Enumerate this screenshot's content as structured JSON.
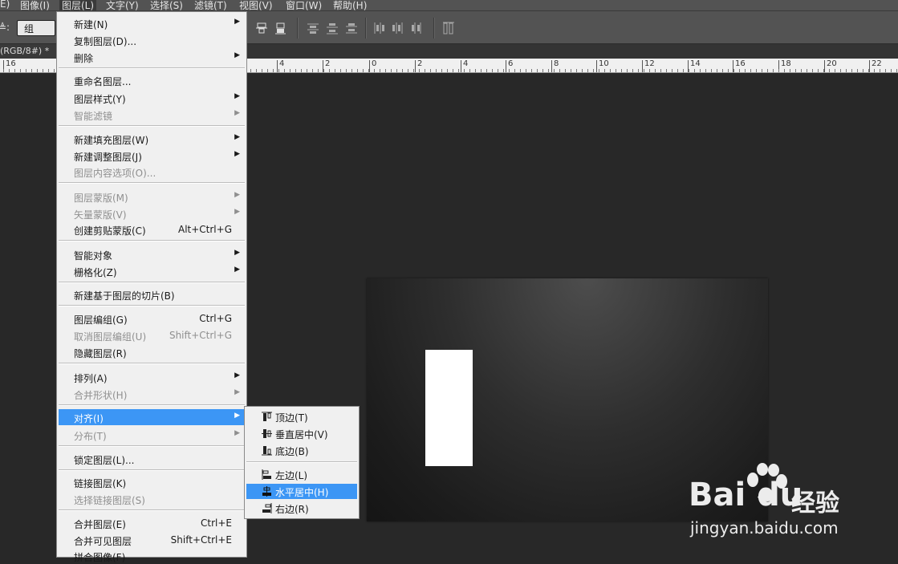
{
  "menubar": {
    "items": [
      {
        "label": "E)"
      },
      {
        "label": "图像(I)"
      },
      {
        "label": "图层(L)"
      },
      {
        "label": "文字(Y)"
      },
      {
        "label": "选择(S)"
      },
      {
        "label": "滤镜(T)"
      },
      {
        "label": "视图(V)"
      },
      {
        "label": "窗口(W)"
      },
      {
        "label": "帮助(H)"
      }
    ]
  },
  "options_bar": {
    "label": "≜:",
    "auto_select_value": "组"
  },
  "document": {
    "tab_title": "(RGB/8#) *",
    "ruler_labels": [
      "16",
      "4",
      "2",
      "0",
      "2",
      "4",
      "6",
      "8",
      "10",
      "12",
      "14",
      "16",
      "18",
      "20",
      "22"
    ]
  },
  "layer_menu": {
    "items": [
      {
        "label": "新建(N)",
        "submenu": true
      },
      {
        "label": "复制图层(D)..."
      },
      {
        "label": "删除",
        "submenu": true
      },
      {
        "label": "重命名图层..."
      },
      {
        "label": "图层样式(Y)",
        "submenu": true
      },
      {
        "label": "智能滤镜",
        "submenu": true,
        "disabled": true
      },
      {
        "label": "新建填充图层(W)",
        "submenu": true
      },
      {
        "label": "新建调整图层(J)",
        "submenu": true
      },
      {
        "label": "图层内容选项(O)...",
        "disabled": true
      },
      {
        "label": "图层蒙版(M)",
        "submenu": true,
        "disabled": true
      },
      {
        "label": "矢量蒙版(V)",
        "submenu": true,
        "disabled": true
      },
      {
        "label": "创建剪贴蒙版(C)",
        "shortcut": "Alt+Ctrl+G"
      },
      {
        "label": "智能对象",
        "submenu": true
      },
      {
        "label": "栅格化(Z)",
        "submenu": true
      },
      {
        "label": "新建基于图层的切片(B)"
      },
      {
        "label": "图层编组(G)",
        "shortcut": "Ctrl+G"
      },
      {
        "label": "取消图层编组(U)",
        "shortcut": "Shift+Ctrl+G",
        "disabled": true
      },
      {
        "label": "隐藏图层(R)"
      },
      {
        "label": "排列(A)",
        "submenu": true
      },
      {
        "label": "合并形状(H)",
        "submenu": true,
        "disabled": true
      },
      {
        "label": "对齐(I)",
        "submenu": true,
        "highlighted": true
      },
      {
        "label": "分布(T)",
        "submenu": true,
        "disabled": true
      },
      {
        "label": "锁定图层(L)..."
      },
      {
        "label": "链接图层(K)"
      },
      {
        "label": "选择链接图层(S)",
        "disabled": true
      },
      {
        "label": "合并图层(E)",
        "shortcut": "Ctrl+E"
      },
      {
        "label": "合并可见图层",
        "shortcut": "Shift+Ctrl+E"
      },
      {
        "label": "拼合图像(F)"
      }
    ]
  },
  "align_submenu": {
    "items": [
      {
        "label": "顶边(T)",
        "icon": "align-top-icon"
      },
      {
        "label": "垂直居中(V)",
        "icon": "align-vertical-center-icon"
      },
      {
        "label": "底边(B)",
        "icon": "align-bottom-icon"
      },
      {
        "label": "左边(L)",
        "icon": "align-left-icon"
      },
      {
        "label": "水平居中(H)",
        "icon": "align-horizontal-center-icon",
        "highlighted": true
      },
      {
        "label": "右边(R)",
        "icon": "align-right-icon"
      }
    ]
  },
  "watermark": {
    "brand": "Bai du",
    "product": "经验",
    "url": "jingyan.baidu.com"
  },
  "colors": {
    "menu_highlight": "#3c96f5",
    "menu_bg": "#f0f0f0",
    "workspace": "#282828",
    "chrome": "#535353"
  }
}
